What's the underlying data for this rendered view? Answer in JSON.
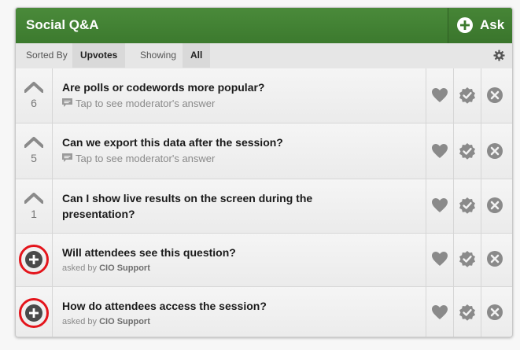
{
  "header": {
    "title": "Social Q&A",
    "ask_label": "Ask"
  },
  "toolbar": {
    "sorted_by_label": "Sorted By",
    "sorted_by_value": "Upvotes",
    "showing_label": "Showing",
    "showing_value": "All"
  },
  "questions": [
    {
      "votes": "6",
      "text": "Are polls or codewords more popular?",
      "subtext": "Tap to see moderator's answer",
      "asked_by_prefix": "",
      "asked_by": ""
    },
    {
      "votes": "5",
      "text": "Can we export this data after the session?",
      "subtext": "Tap to see moderator's answer",
      "asked_by_prefix": "",
      "asked_by": ""
    },
    {
      "votes": "1",
      "text": "Can I show live results on the screen during the presentation?",
      "subtext": "",
      "asked_by_prefix": "",
      "asked_by": ""
    },
    {
      "votes": "",
      "text": "Will attendees see this question?",
      "subtext": "",
      "asked_by_prefix": "asked by",
      "asked_by": "CIO Support"
    },
    {
      "votes": "",
      "text": "How do attendees access the session?",
      "subtext": "",
      "asked_by_prefix": "asked by",
      "asked_by": "CIO Support"
    }
  ],
  "icons": {
    "upvote": "chevron-up-icon",
    "add_vote": "plus-circle-icon",
    "like": "heart-icon",
    "approve": "check-badge-icon",
    "dismiss": "close-circle-icon",
    "settings": "gear-icon",
    "moderator_answer": "chat-bubble-icon"
  },
  "colors": {
    "header_green": "#3f7d31",
    "highlight_red": "#e4141b",
    "icon_gray": "#8a8a8a"
  }
}
